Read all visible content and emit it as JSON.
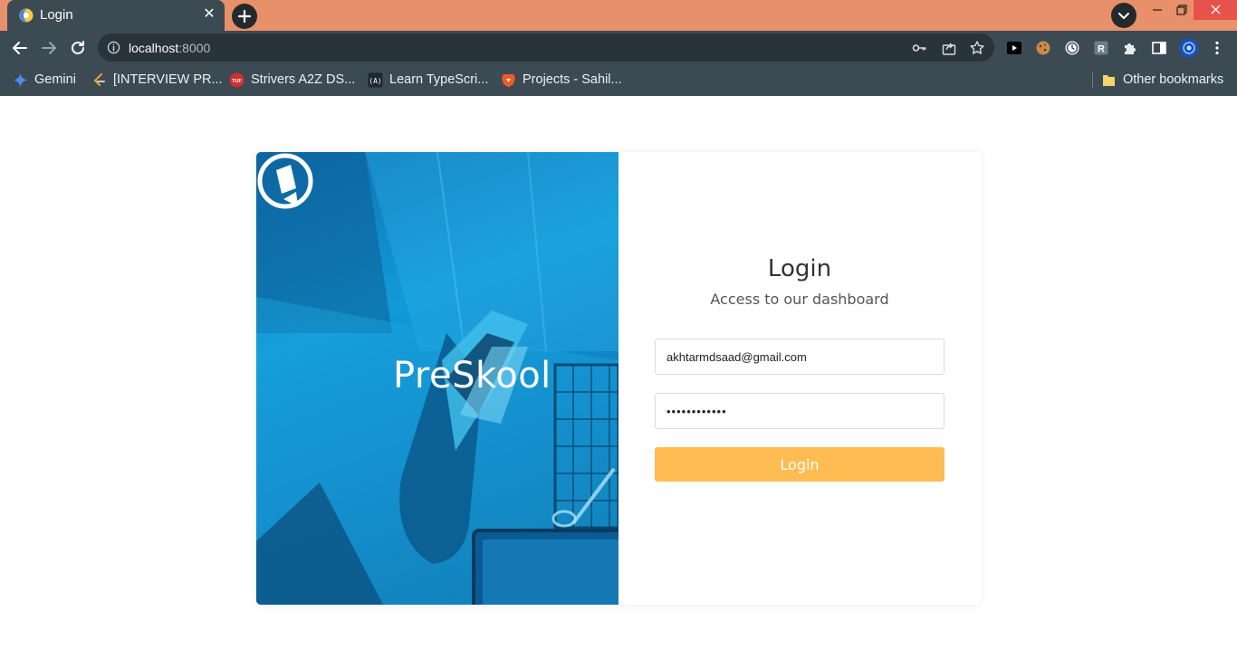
{
  "browser": {
    "tab": {
      "title": "Login",
      "favicon": "globe-favicon-icon"
    },
    "window_controls": [
      "minimize-icon",
      "restore-icon",
      "close-icon"
    ],
    "address_bar": {
      "host": "localhost",
      "port": ":8000"
    },
    "bookmarks": [
      {
        "label": "Gemini",
        "icon": "gemini-sparkle-icon",
        "color": "#4a8cf7"
      },
      {
        "label": "[INTERVIEW PR...",
        "icon": "leetcode-icon",
        "color": "#f0a030"
      },
      {
        "label": "Strivers A2Z DS...",
        "icon": "tuf-icon",
        "color": "#d32f2f"
      },
      {
        "label": "Learn TypeScri...",
        "icon": "typescript-icon",
        "color": "#1d2730"
      },
      {
        "label": "Projects - Sahil...",
        "icon": "brave-icon",
        "color": "#f15a24"
      }
    ],
    "other_bookmarks": {
      "label": "Other bookmarks",
      "icon": "folder-icon",
      "color": "#f5d56b"
    }
  },
  "page": {
    "brand": {
      "name": "PreSkool",
      "logo": "preskool-book-logo-icon"
    },
    "login": {
      "title": "Login",
      "subtitle": "Access to our dashboard",
      "email_value": "akhtarmdsaad@gmail.com",
      "password_value": "••••••••••••",
      "button_label": "Login"
    },
    "colors": {
      "accent": "#ffbc53",
      "hero_blue": "#129ad8"
    }
  }
}
